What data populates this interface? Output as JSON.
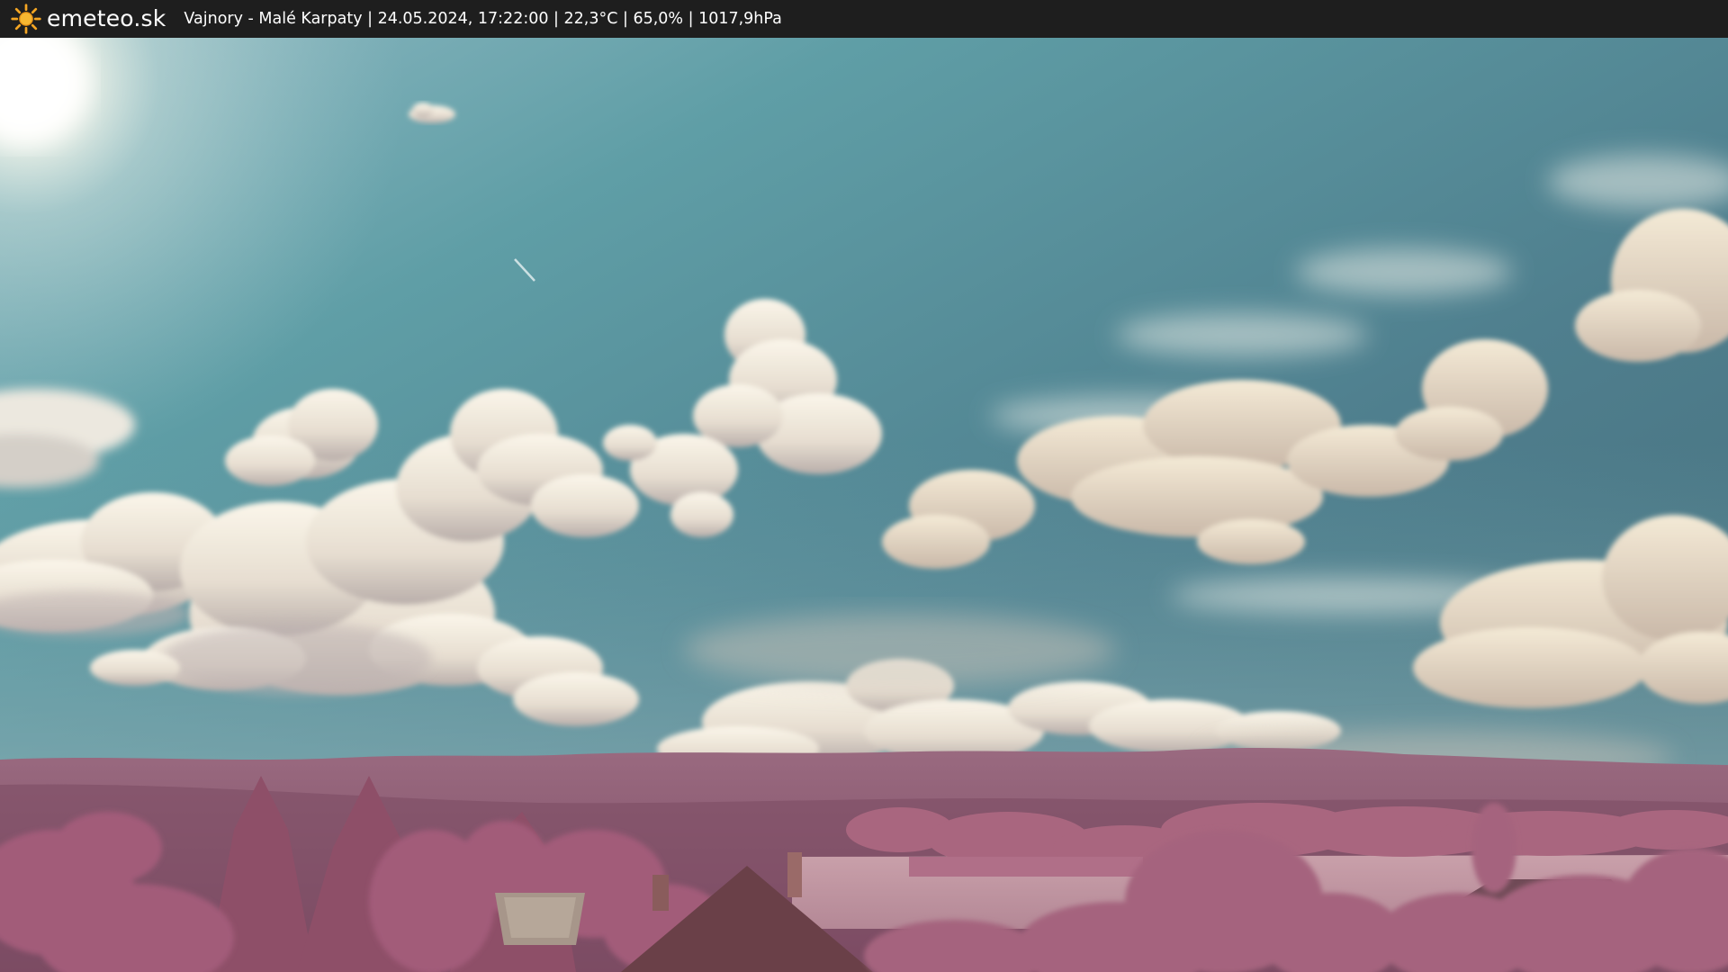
{
  "header": {
    "brand": "emeteo.sk",
    "logo_icon": "sun-icon",
    "info_line": "Vajnory - Malé Karpaty | 24.05.2024, 17:22:00 | 22,3°C | 65,0% | 1017,9hPa"
  },
  "colors": {
    "bar_bg": "#1e1e1e",
    "logo_sun": "#f5a623",
    "sky_top": "#3f6271",
    "sky_mid": "#5f9ea6",
    "hills": "#8a5870",
    "foliage": "#a5647e"
  }
}
